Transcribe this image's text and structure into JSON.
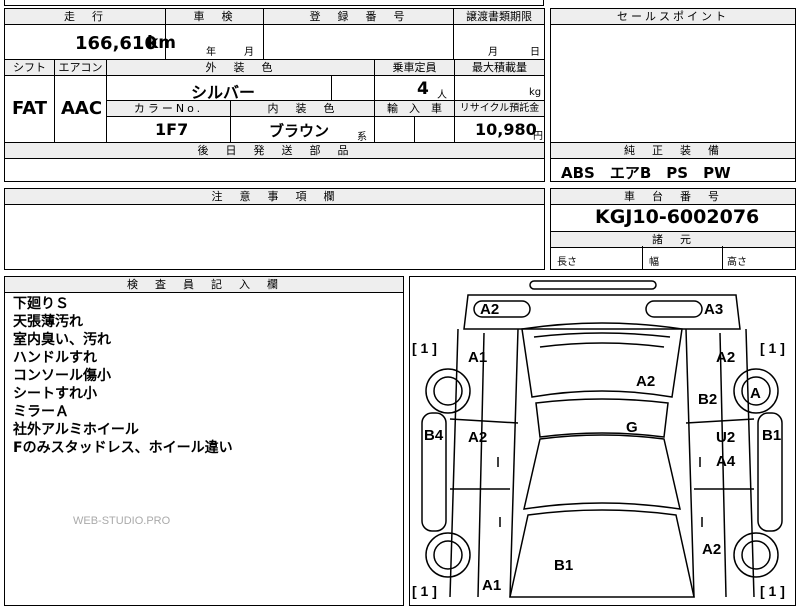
{
  "top_strip": {
    "frag1": "",
    "frag2": ""
  },
  "mileage": {
    "header": "走　行",
    "value": "166,610",
    "unit": "km"
  },
  "inspection": {
    "header": "車　検",
    "year_unit": "年",
    "month_unit": "月"
  },
  "registration": {
    "header": "登　録　番　号"
  },
  "transfer_deadline": {
    "header": "譲渡書類期限",
    "month_unit": "月",
    "day_unit": "日"
  },
  "sales_point": {
    "header": "セールスポイント"
  },
  "shift": {
    "header": "シフト",
    "value": "FAT"
  },
  "aircon": {
    "header": "エアコン",
    "value": "AAC"
  },
  "exterior_color": {
    "header": "外　装　色",
    "value": "シルバー"
  },
  "capacity": {
    "header": "乗車定員",
    "value": "4",
    "unit": "人"
  },
  "max_load": {
    "header": "最大積載量",
    "unit": "kg"
  },
  "color_no": {
    "header": "カラーNo.",
    "value": "1F7"
  },
  "interior_color": {
    "header": "内　装　色",
    "value": "ブラウン",
    "suffix": "系"
  },
  "import_car": {
    "header": "輸　入　車"
  },
  "recycle": {
    "header": "リサイクル預託金",
    "value": "10,980",
    "unit": "円"
  },
  "later_parts": {
    "header": "後　日　発　送　部　品"
  },
  "equipment": {
    "header": "純　正　装　備",
    "value": "ABS　エアB　PS　PW"
  },
  "caution": {
    "header": "注　意　事　項　欄"
  },
  "chassis": {
    "header": "車　台　番　号",
    "value": "KGJ10-6002076"
  },
  "specs": {
    "header": "諸　元",
    "length": "長さ",
    "width": "幅",
    "height": "高さ"
  },
  "inspector": {
    "header": "検　査　員　記　入　欄",
    "notes": [
      "下廻りＳ",
      "天張薄汚れ",
      "室内臭い、汚れ",
      "ハンドルすれ",
      "コンソール傷小",
      "シートすれ小",
      "ミラーＡ",
      "社外アルミホイール",
      "Fのみスタッドレス、ホイール違い"
    ]
  },
  "watermark": "WEB-STUDIO.PRO",
  "diagram": {
    "rear_left": "A2",
    "rear_right": "A3",
    "left_rear_door": "A1",
    "roof_rear": "A2",
    "right_rear_quarter": "A2",
    "right_rear_wheel": "A",
    "right_rear_panel": "B2",
    "left_sill": "B4",
    "left_door": "A2",
    "roof": "G",
    "right_door_top": "U2",
    "right_door_bottom": "A4",
    "right_sill": "B1",
    "right_front": "A2",
    "hood": "B1",
    "left_front": "A1",
    "bracket_tl": "[ 1 ]",
    "bracket_tr": "[ 1 ]",
    "bracket_bl": "[ 1 ]",
    "bracket_br": "[ 1 ]"
  }
}
